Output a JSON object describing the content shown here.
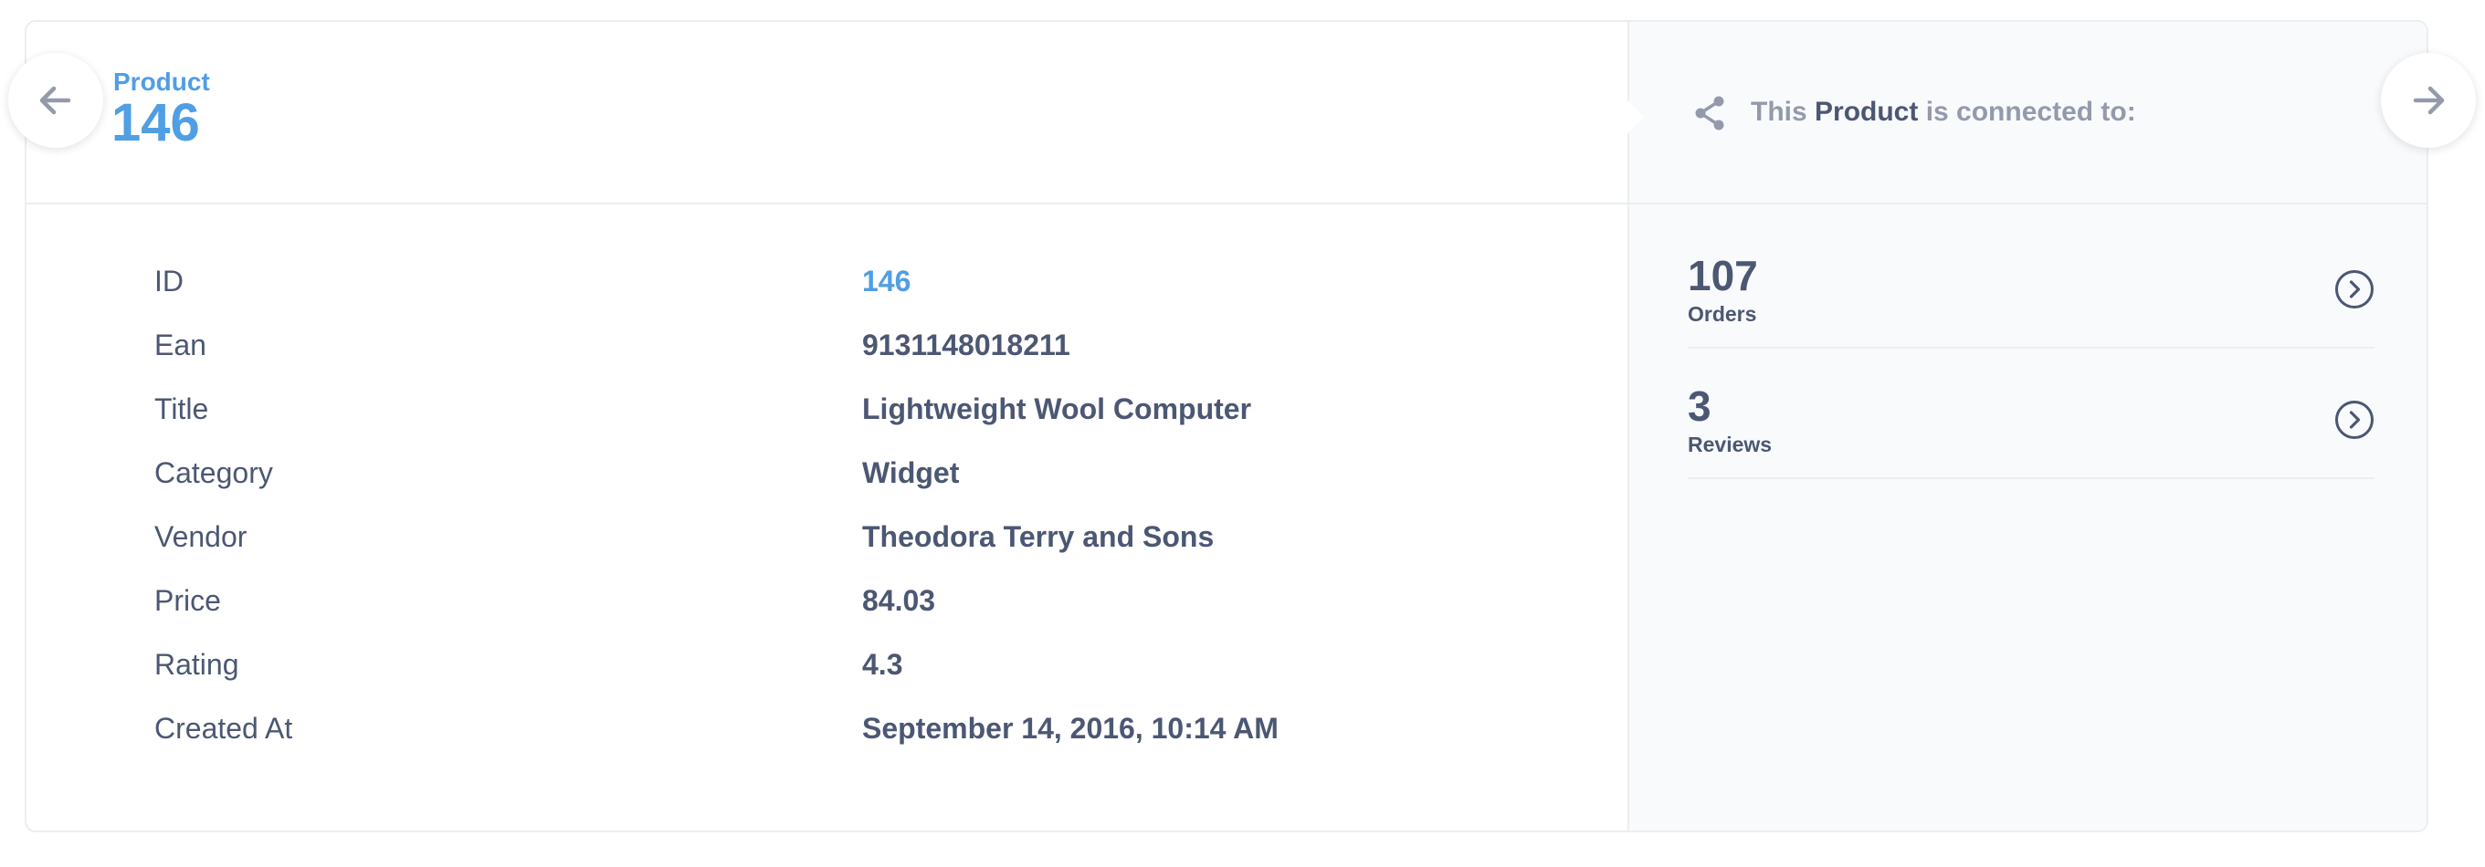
{
  "header": {
    "entity_type": "Product",
    "entity_id": "146"
  },
  "fields": [
    {
      "label": "ID",
      "value": "146"
    },
    {
      "label": "Ean",
      "value": "9131148018211"
    },
    {
      "label": "Title",
      "value": "Lightweight Wool Computer"
    },
    {
      "label": "Category",
      "value": "Widget"
    },
    {
      "label": "Vendor",
      "value": "Theodora Terry and Sons"
    },
    {
      "label": "Price",
      "value": "84.03"
    },
    {
      "label": "Rating",
      "value": "4.3"
    },
    {
      "label": "Created At",
      "value": "September 14, 2016, 10:14 AM"
    }
  ],
  "relationships": {
    "prefix": "This ",
    "entity": "Product",
    "suffix": " is connected to:",
    "items": [
      {
        "count": "107",
        "label": "Orders"
      },
      {
        "count": "3",
        "label": "Reviews"
      }
    ]
  },
  "icons": {
    "prev": "arrow-left-icon",
    "next": "arrow-right-icon",
    "share": "share-icon",
    "chevron": "chevron-right-circle-icon"
  },
  "colors": {
    "accent": "#509ee3",
    "text": "#4c5773",
    "muted": "#949aab",
    "panel_bg": "#f9fafc",
    "border": "#ebeef0"
  }
}
